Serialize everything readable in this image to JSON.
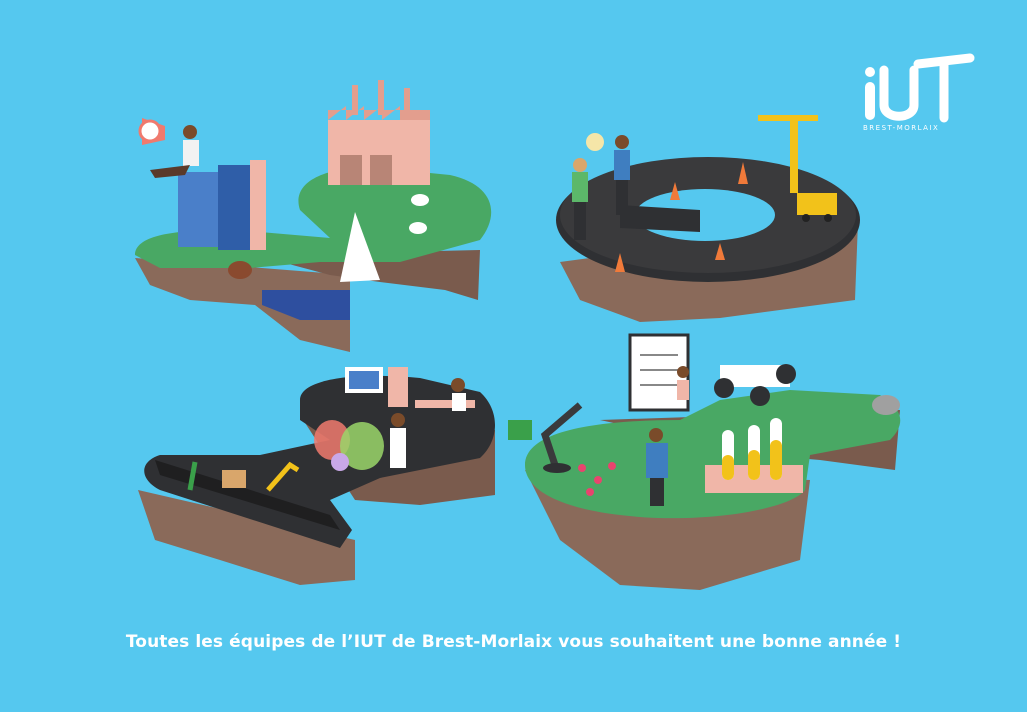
{
  "caption": "Toutes les équipes de l’IUT de Brest-Morlaix vous souhaitent une bonne année !",
  "logo": {
    "name": "IUT Brest-Morlaix",
    "wordmark": "iUT",
    "subtitle": "BREST-MORLAIX"
  },
  "colors": {
    "background": "#55c8ef",
    "grass": "#49a864",
    "rock": "#8a6a5a",
    "road": "#3a3a3c",
    "text": "#ffffff"
  }
}
